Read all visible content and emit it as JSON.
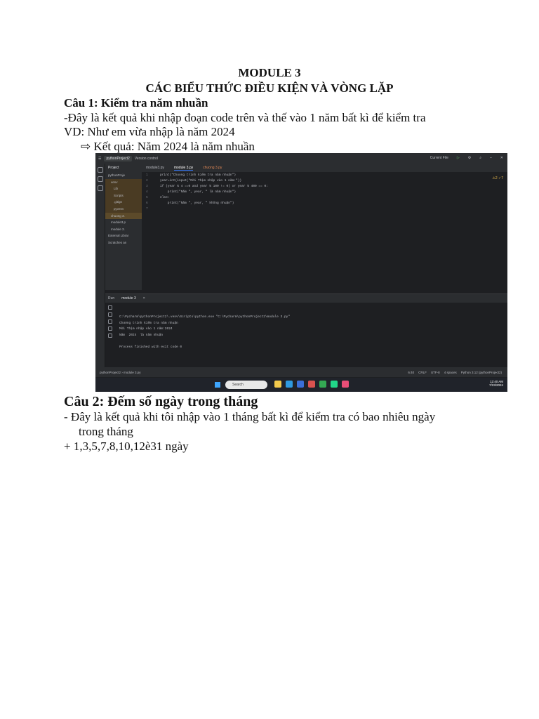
{
  "doc": {
    "title": "MODULE 3",
    "subtitle": "CÁC BIỂU THỨC ĐIỀU KIỆN VÀ VÒNG LẶP",
    "q1_heading": "Câu 1: Kiểm tra năm nhuần",
    "q1_line1": "-Đây là kết quả khi nhập đoạn code trên và thế vào 1 năm bất kì để kiểm tra",
    "q1_line2": "VD: Như em vừa nhập là năm 2024",
    "q1_result": "⇨  Kết quả: Năm 2024 là năm nhuần",
    "q2_heading": "Câu 2: Đếm số ngày trong tháng",
    "q2_line1": "-    Đây là kết quả khi tôi nhập vào 1 tháng bất kì để kiểm tra có bao nhiêu ngày",
    "q2_line2": "trong tháng",
    "q2_line3": "+ 1,3,5,7,8,10,12è31 ngày"
  },
  "ide": {
    "project_name": "pythonProject2",
    "version_control": "Version control",
    "run_config": "Current File",
    "project_label": "Project",
    "tree": [
      "pythonProje",
      "venv",
      "Lib",
      "Scripts",
      ".gitign",
      "pyvenv",
      "chuong 3.",
      "module3.p",
      "module 3.",
      "External Librar",
      "Scratches an"
    ],
    "tabs": [
      "module3.py",
      "module 3.py",
      "chuong 3.py"
    ],
    "warnings": "⚠2  ✓7",
    "code_lines": [
      {
        "n": "1",
        "t": "print(\"Chuong trinh kiểm tra năm nhuận\")"
      },
      {
        "n": "2",
        "t": "year=int(input(\"Mời Thịm nhập vào 1 năm:\"))"
      },
      {
        "n": "3",
        "t": "if (year % 4 ==0 and year % 100 != 0) or year % 400 == 0:"
      },
      {
        "n": "4",
        "t": "    print(\"Năm \", year, \" là năm nhuận\")"
      },
      {
        "n": "5",
        "t": "else:"
      },
      {
        "n": "6",
        "t": "    print(\"Năm \", year, \" không nhuận\")"
      },
      {
        "n": "7",
        "t": ""
      }
    ],
    "run_label": "Run",
    "run_tab": "module 3",
    "output": [
      "C:\\Pycharm\\pythonProject2\\.venv\\Scripts\\python.exe \"C:\\Pycharm\\pythonProject2\\module 3.py\"",
      "Chương trình kiểm tra năm nhuận",
      "Mời Thịm nhập vào 1 năm:2024",
      "Năm  2024  là năm nhuận",
      "",
      "Process finished with exit code 0"
    ],
    "status_left": "pythonProject2 › module 3.py",
    "status_right": [
      "6:40",
      "CRLF",
      "UTF-8",
      "4 spaces",
      "Python 3.12 (pythonProject2)"
    ],
    "taskbar_search": "Search",
    "tray_time": "12:40 AM",
    "tray_date": "7/23/2024"
  }
}
